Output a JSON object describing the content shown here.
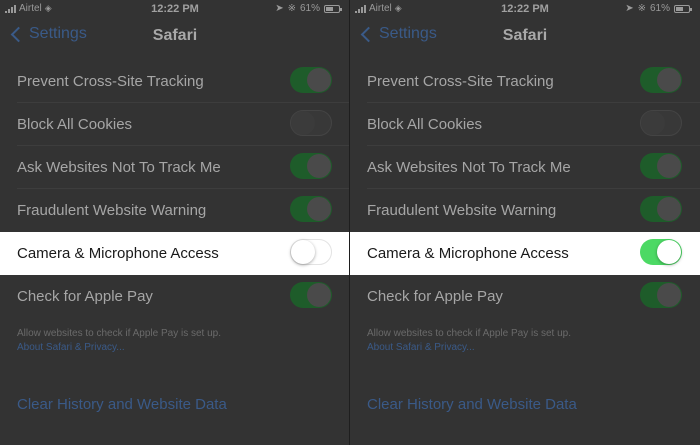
{
  "panels": [
    {
      "status": {
        "carrier": "Airtel",
        "time": "12:22 PM",
        "battery": "61%",
        "battery_level": 0.61
      },
      "nav": {
        "back_label": "Settings",
        "title": "Safari"
      },
      "rows": [
        {
          "label": "Prevent Cross-Site Tracking",
          "toggle": "on"
        },
        {
          "label": "Block All Cookies",
          "toggle": "off"
        },
        {
          "label": "Ask Websites Not To Track Me",
          "toggle": "on"
        },
        {
          "label": "Fraudulent Website Warning",
          "toggle": "on"
        },
        {
          "label": "Camera & Microphone Access",
          "toggle": "off",
          "highlighted": true
        },
        {
          "label": "Check for Apple Pay",
          "toggle": "on"
        }
      ],
      "footer_note": "Allow websites to check if Apple Pay is set up.",
      "footer_link": "About Safari & Privacy...",
      "clear_link": "Clear History and Website Data"
    },
    {
      "status": {
        "carrier": "Airtel",
        "time": "12:22 PM",
        "battery": "61%",
        "battery_level": 0.61
      },
      "nav": {
        "back_label": "Settings",
        "title": "Safari"
      },
      "rows": [
        {
          "label": "Prevent Cross-Site Tracking",
          "toggle": "on"
        },
        {
          "label": "Block All Cookies",
          "toggle": "off"
        },
        {
          "label": "Ask Websites Not To Track Me",
          "toggle": "on"
        },
        {
          "label": "Fraudulent Website Warning",
          "toggle": "on"
        },
        {
          "label": "Camera & Microphone Access",
          "toggle": "on",
          "highlighted": true
        },
        {
          "label": "Check for Apple Pay",
          "toggle": "on"
        }
      ],
      "footer_note": "Allow websites to check if Apple Pay is set up.",
      "footer_link": "About Safari & Privacy...",
      "clear_link": "Clear History and Website Data"
    }
  ],
  "colors": {
    "toggle_on_highlight": "#4cd964",
    "toggle_on_dimmed": "#1e5c2a",
    "link": "#3a5a88",
    "highlight_row": "#ffffff"
  }
}
